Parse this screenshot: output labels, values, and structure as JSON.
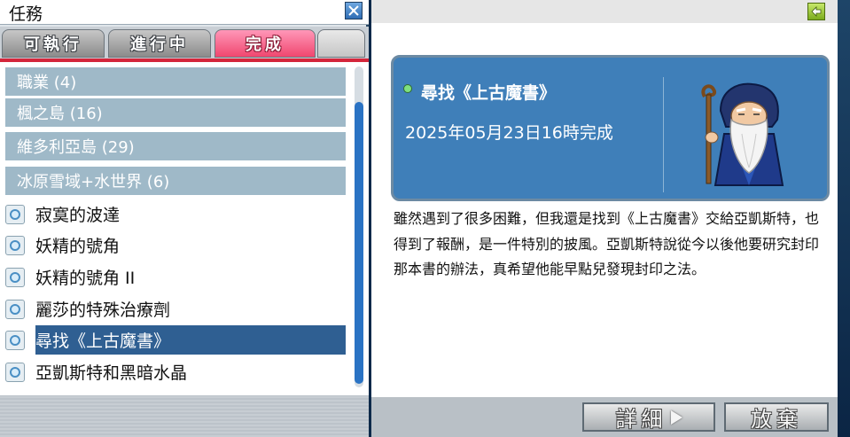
{
  "left_window": {
    "title": "任務",
    "tabs": [
      {
        "label": "可執行",
        "active": false
      },
      {
        "label": "進行中",
        "active": false
      },
      {
        "label": "完成",
        "active": true
      },
      {
        "label": "",
        "active": false
      }
    ],
    "categories": [
      {
        "label": "職業 (4)"
      },
      {
        "label": "楓之島 (16)"
      },
      {
        "label": "維多利亞島 (29)"
      },
      {
        "label": "冰原雪域+水世界 (6)"
      }
    ],
    "quests": [
      {
        "label": "寂寞的波達",
        "selected": false
      },
      {
        "label": "妖精的號角",
        "selected": false
      },
      {
        "label": "妖精的號角 II",
        "selected": false
      },
      {
        "label": "麗莎的特殊治療劑",
        "selected": false
      },
      {
        "label": "尋找《上古魔書》",
        "selected": true
      },
      {
        "label": "亞凱斯特和黑暗水晶",
        "selected": false
      }
    ]
  },
  "detail": {
    "quest_title": "尋找《上古魔書》",
    "completed_at": "2025年05月23日16時完成",
    "npc_icon": "old-wizard-npc",
    "description": "雖然遇到了很多困難，但我還是找到《上古魔書》交給亞凱斯特，也得到了報酬，是一件特別的披風。亞凱斯特說從今以後他要研究封印那本書的辦法，真希望他能早點兒發現封印之法。",
    "buttons": {
      "details": "詳細",
      "abandon": "放棄"
    }
  },
  "colors": {
    "active_tab": "#f0476f",
    "category_row": "#9fb9c8",
    "selected_row": "#2f5f92",
    "card_background": "#3f7fb9",
    "scrollbar": "#2a73c4"
  }
}
